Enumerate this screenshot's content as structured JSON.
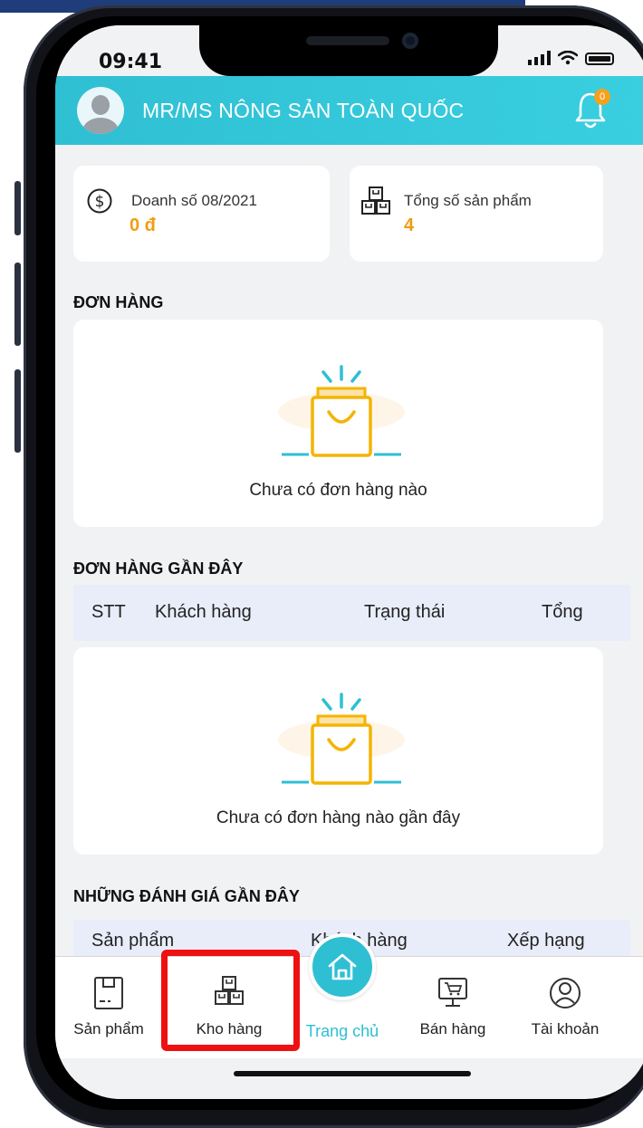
{
  "status_bar": {
    "time": "09:41"
  },
  "header": {
    "store_name": "MR/MS NÔNG SẢN TOÀN QUỐC",
    "notification_count": "0"
  },
  "stats": [
    {
      "label": "Doanh số 08/2021",
      "value": "0 đ",
      "icon": "dollar-circle-icon"
    },
    {
      "label": "Tổng số sản phẩm",
      "value": "4",
      "icon": "boxes-icon"
    }
  ],
  "orders": {
    "title": "ĐƠN HÀNG",
    "empty_text": "Chưa có đơn hàng nào"
  },
  "recent_orders": {
    "title": "ĐƠN HÀNG GẦN ĐÂY",
    "columns": [
      "STT",
      "Khách hàng",
      "Trạng thái",
      "Tổng"
    ],
    "empty_text": "Chưa có đơn hàng nào gần đây"
  },
  "recent_reviews": {
    "title": "NHỮNG ĐÁNH GIÁ GẦN ĐÂY",
    "columns": [
      "Sản phẩm",
      "Khách hàng",
      "Xếp hạng"
    ]
  },
  "bottom_nav": [
    {
      "label": "Sản phẩm",
      "icon": "product-box-icon"
    },
    {
      "label": "Kho hàng",
      "icon": "warehouse-boxes-icon"
    },
    {
      "label": "Trang chủ",
      "icon": "home-icon",
      "active": true
    },
    {
      "label": "Bán hàng",
      "icon": "pos-cart-icon"
    },
    {
      "label": "Tài khoản",
      "icon": "account-icon"
    }
  ],
  "colors": {
    "accent": "#2fbfd3",
    "value_orange": "#f39c12",
    "highlight_red": "#ee1111"
  }
}
